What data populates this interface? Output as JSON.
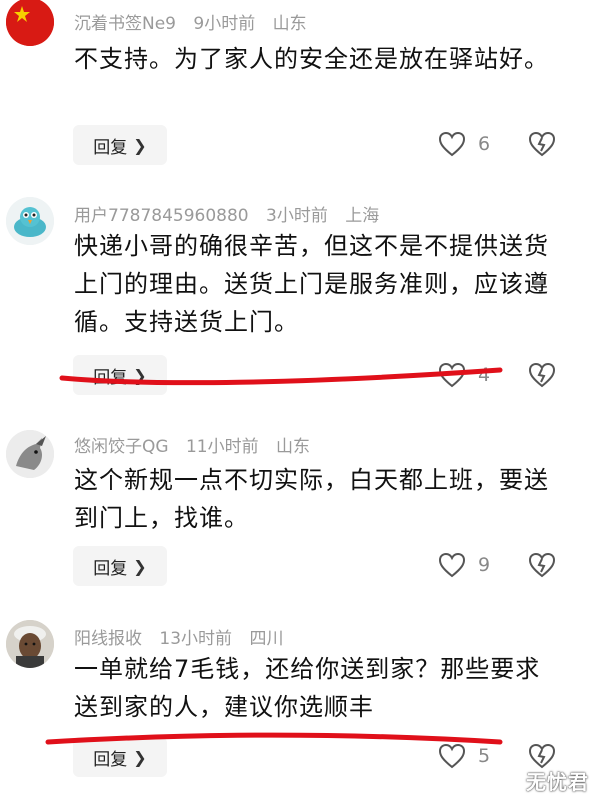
{
  "comments": [
    {
      "username": "沉着书签Ne9",
      "time": "9小时前",
      "location": "山东",
      "text": "不支持。为了家人的安全还是放在驿站好。",
      "reply_label": "回复",
      "likes": "6",
      "avatar": "red-flag-avatar"
    },
    {
      "username": "用户7787845960880",
      "time": "3小时前",
      "location": "上海",
      "text": "快递小哥的确很辛苦，但这不是不提供送货上门的理由。送货上门是服务准则，应该遵循。支持送货上门。",
      "reply_label": "回复",
      "likes": "4",
      "avatar": "cartoon-bird-avatar"
    },
    {
      "username": "悠闲饺子QG",
      "time": "11小时前",
      "location": "山东",
      "text": "这个新规一点不切实际，白天都上班，要送到门上，找谁。",
      "reply_label": "回复",
      "likes": "9",
      "avatar": "goat-avatar"
    },
    {
      "username": "阳线报收",
      "time": "13小时前",
      "location": "四川",
      "text": "一单就给7毛钱，还给你送到家？那些要求送到家的人，建议你选顺丰",
      "reply_label": "回复",
      "likes": "5",
      "avatar": "old-man-avatar"
    }
  ],
  "watermark": "无忧君",
  "colors": {
    "underline": "#e0101a",
    "meta": "#9a9a9a",
    "text": "#111111"
  }
}
